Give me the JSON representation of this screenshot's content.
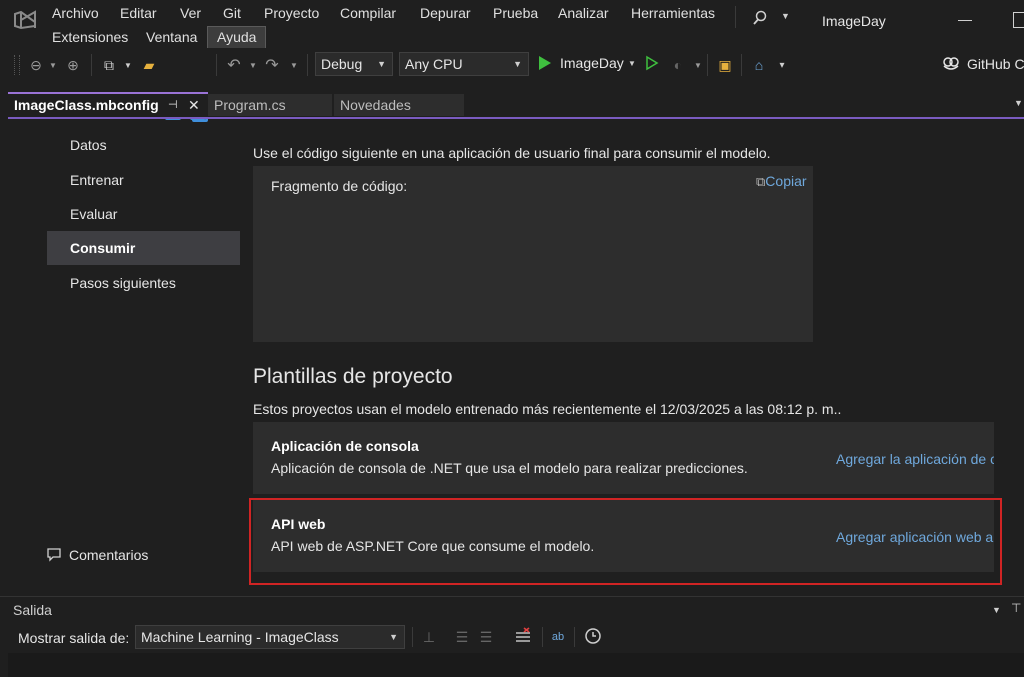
{
  "menubar": {
    "items": [
      "Archivo",
      "Editar",
      "Ver",
      "Git",
      "Proyecto",
      "Compilar",
      "Depurar",
      "Prueba",
      "Analizar",
      "Herramientas"
    ],
    "row2": [
      "Extensiones",
      "Ventana",
      "Ayuda"
    ],
    "solution_title": "ImageDay"
  },
  "toolbar": {
    "config": "Debug",
    "platform": "Any CPU",
    "run_target": "ImageDay",
    "github": "GitHub C"
  },
  "tabs": [
    "ImageClass.mbconfig",
    "Program.cs",
    "Novedades"
  ],
  "nav": {
    "items": [
      "Datos",
      "Entrenar",
      "Evaluar",
      "Consumir",
      "Pasos siguientes"
    ],
    "feedback": "Comentarios"
  },
  "consume": {
    "intro": "Use el código siguiente en una aplicación de usuario final para consumir el modelo.",
    "snippet_label": "Fragmento de código:",
    "copy_label": "Copiar"
  },
  "templates": {
    "heading": "Plantillas de proyecto",
    "subtitle": "Estos proyectos usan el modelo entrenado más recientemente el 12/03/2025 a las 08:12 p. m..",
    "console": {
      "title": "Aplicación de consola",
      "desc": "Aplicación de consola de .NET que usa el modelo para realizar predicciones.",
      "action": "Agregar la aplicación de c"
    },
    "webapi": {
      "title": "API web",
      "desc": "API web de ASP.NET Core que consume el modelo.",
      "action": "Agregar aplicación web a"
    }
  },
  "output": {
    "title": "Salida",
    "show_label": "Mostrar salida de:",
    "source": "Machine Learning - ImageClass"
  }
}
